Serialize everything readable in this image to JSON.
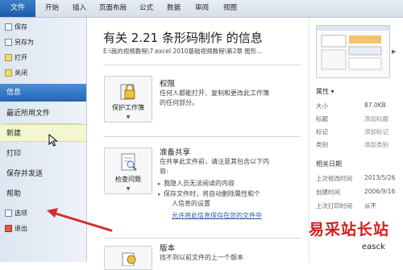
{
  "ribbon": {
    "tabs": [
      "文件",
      "开始",
      "插入",
      "页面布局",
      "公式",
      "数据",
      "审阅",
      "视图"
    ]
  },
  "nav": {
    "small_top": [
      "保存",
      "另存为",
      "打开",
      "关闭"
    ],
    "big": [
      "信息",
      "最近所用文件",
      "新建",
      "打印",
      "保存并发送",
      "帮助"
    ],
    "small_bottom": [
      "选项",
      "退出"
    ],
    "active": "信息",
    "hover": "新建"
  },
  "info": {
    "title": "有关 2.21 条形码制作 的信息",
    "path": "E:\\我的视频教程\\7.excel 2010基础视频教程\\第2章 图形..."
  },
  "sections": {
    "permissions": {
      "button": "保护工作簿",
      "heading": "权限",
      "text": [
        "任何人都能打开、复制和更改此工作簿",
        "的任何部分。"
      ]
    },
    "prepare": {
      "button": "检查问题",
      "heading": "准备共享",
      "text": [
        "在共享此文件前，请注意其包含以下内",
        "容:"
      ],
      "bullets": [
        "我隐人员无法阅读的内容",
        "保存文件时，将自动删除属性和个",
        "人信息的设置"
      ],
      "link": "允许将此信息保存在您的文件中"
    },
    "versions": {
      "heading": "版本",
      "text": "找不到以前文件的上一个版本"
    }
  },
  "properties": {
    "heading": "属性 ▾",
    "rows": [
      {
        "key": "大小",
        "value": "87.0KB"
      },
      {
        "key": "标题",
        "value": "添加标题"
      },
      {
        "key": "标记",
        "value": "添加标记"
      },
      {
        "key": "类别",
        "value": "添加类别"
      }
    ],
    "dates_heading": "相关日期",
    "dates": [
      {
        "key": "上次修改时间",
        "value": "2013/5/26"
      },
      {
        "key": "创建时间",
        "value": "2006/9/16"
      },
      {
        "key": "上次打印时间",
        "value": "从不"
      }
    ]
  },
  "watermark": {
    "main": "易采站长站",
    "sub": "easck"
  },
  "colors": {
    "file_tab": "#1e5aa8",
    "active_nav": "#2366b5",
    "arrow": "#d32f2f",
    "watermark": "#d61b1b"
  }
}
